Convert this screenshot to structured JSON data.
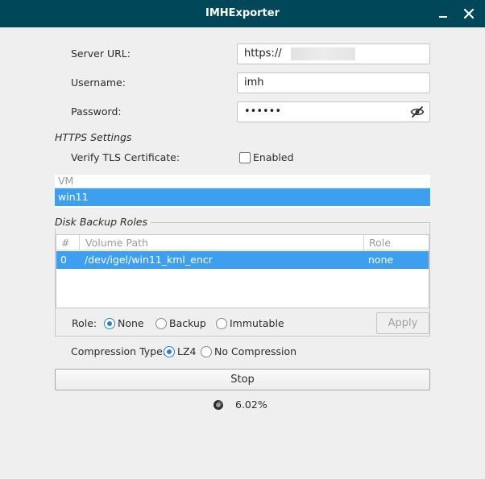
{
  "window": {
    "title": "IMHExporter",
    "minimize_icon": "minimize-icon",
    "close_icon": "close-icon"
  },
  "form": {
    "server_url_label": "Server URL:",
    "server_url_value": "https://",
    "username_label": "Username:",
    "username_value": "imh",
    "password_label": "Password:",
    "password_value": "••••••",
    "password_toggle_icon": "eye-slash-icon"
  },
  "https": {
    "section_title": "HTTPS Settings",
    "verify_label": "Verify TLS Certificate:",
    "checkbox_label": "Enabled",
    "checked": false
  },
  "vm_list": {
    "header": "VM",
    "items": [
      {
        "name": "win11",
        "selected": true
      }
    ]
  },
  "disk_roles": {
    "group_title": "Disk Backup Roles",
    "columns": [
      "#",
      "Volume Path",
      "Role"
    ],
    "rows": [
      {
        "index": "0",
        "path": "/dev/igel/win11_kml_encr",
        "role": "none",
        "selected": true
      }
    ],
    "role_label": "Role:",
    "role_options": [
      "None",
      "Backup",
      "Immutable"
    ],
    "role_selected": "None",
    "apply_label": "Apply"
  },
  "compression": {
    "label": "Compression Type:",
    "options": [
      "LZ4",
      "No Compression"
    ],
    "selected": "LZ4"
  },
  "actions": {
    "stop_label": "Stop"
  },
  "progress": {
    "text": "6.02%",
    "percent": 6.02,
    "spinner_icon": "spinner-icon"
  },
  "colors": {
    "titlebar": "#00475a",
    "selection": "#3d9fef",
    "radio_accent": "#2a7fd0",
    "window_bg": "#efefef"
  }
}
